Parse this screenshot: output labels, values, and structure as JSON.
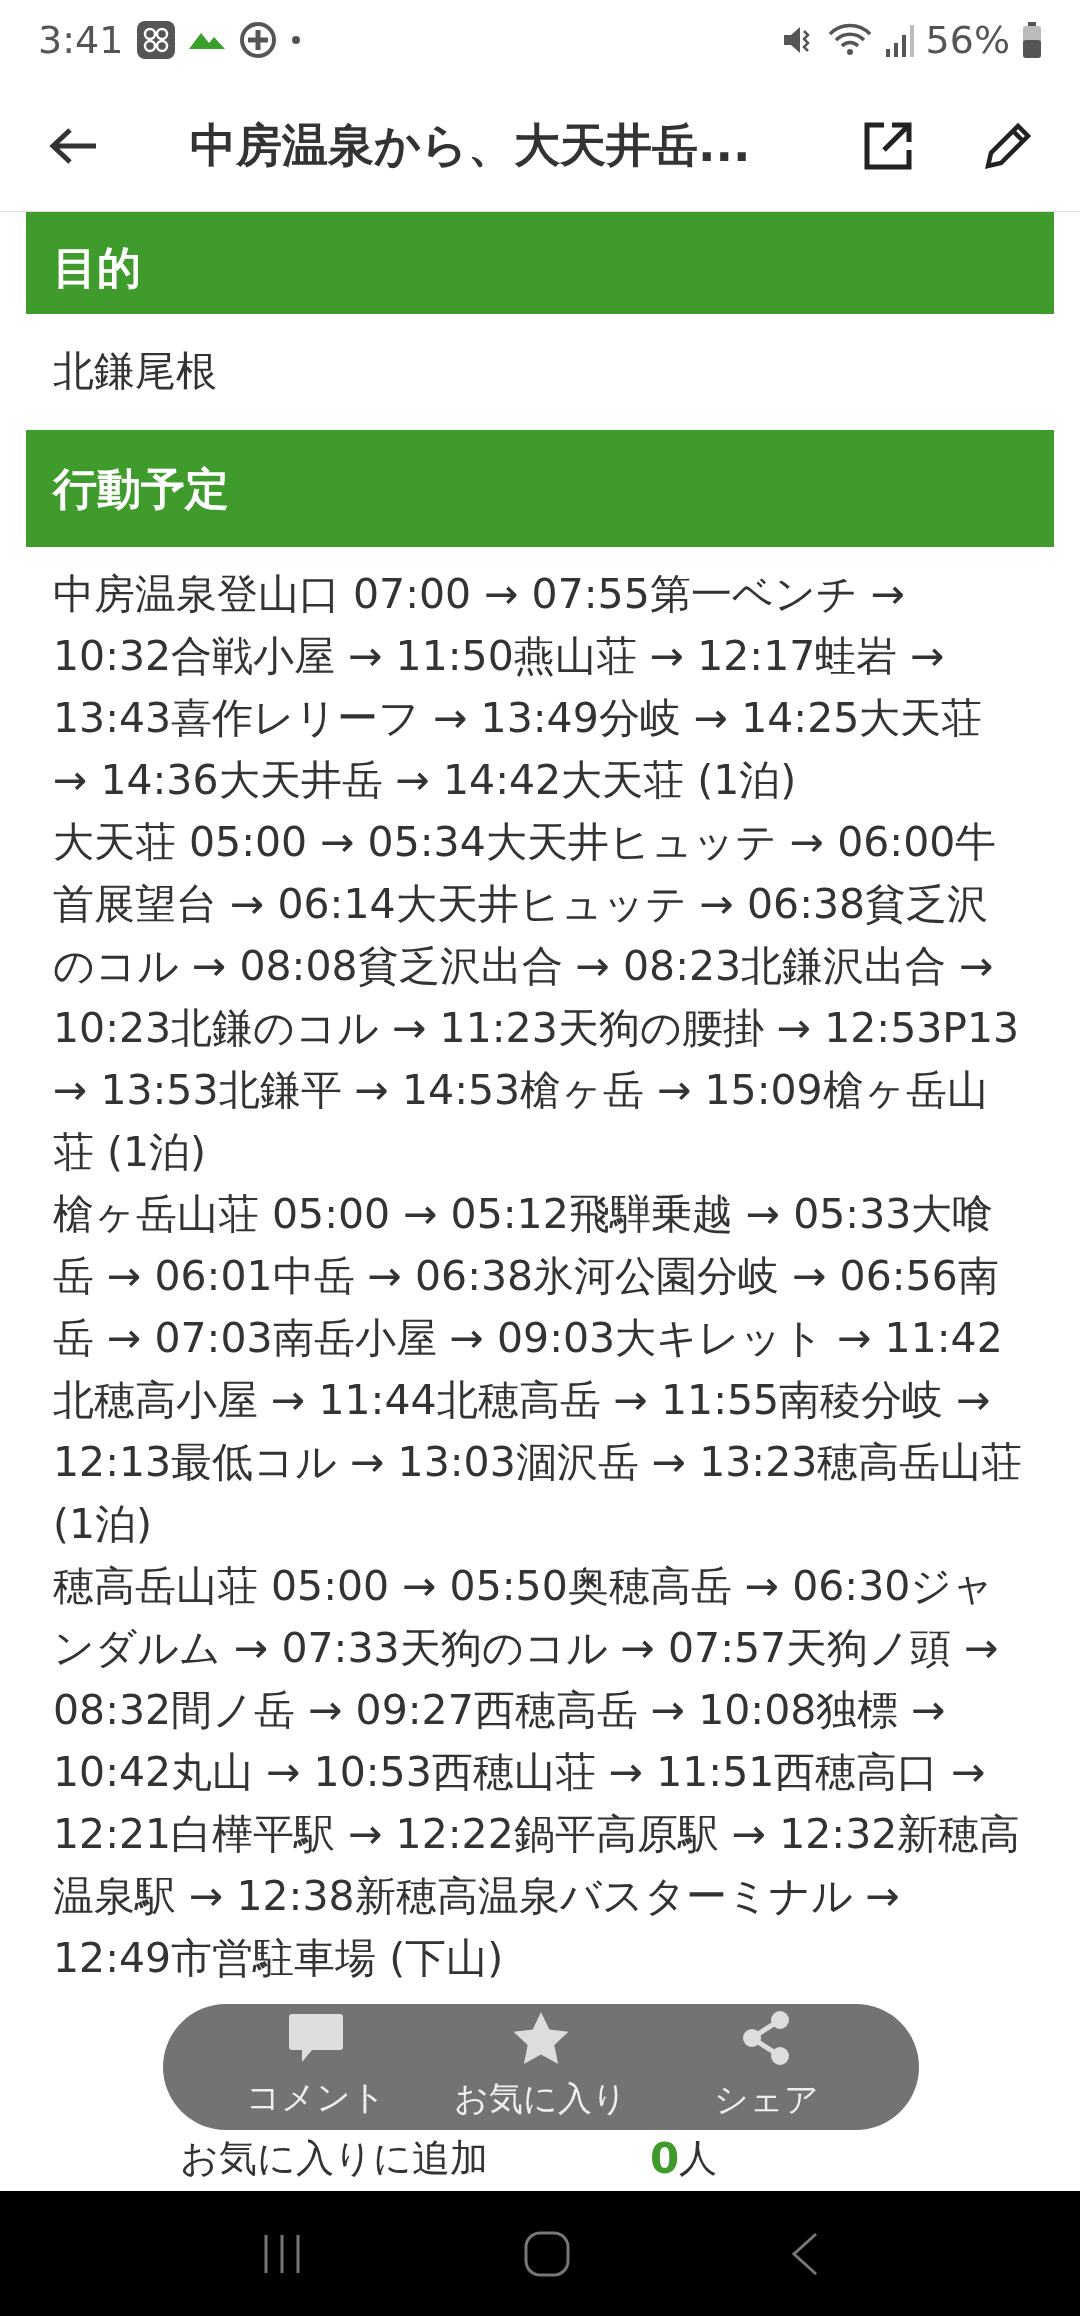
{
  "status_bar": {
    "time": "3:41",
    "battery": "56%"
  },
  "header": {
    "title": "中房温泉から、大天井岳..."
  },
  "sections": [
    {
      "heading": "目的",
      "paragraphs": [
        "北鎌尾根"
      ]
    },
    {
      "heading": "行動予定",
      "paragraphs": [
        "中房温泉登山口 07:00 → 07:55第一ベンチ → 10:32合戦小屋 → 11:50燕山荘 → 12:17蛙岩 → 13:43喜作レリーフ → 13:49分岐 → 14:25大天荘 → 14:36大天井岳 → 14:42大天荘 (1泊)",
        "大天荘 05:00 → 05:34大天井ヒュッテ → 06:00牛首展望台 → 06:14大天井ヒュッテ → 06:38貧乏沢のコル → 08:08貧乏沢出合 → 08:23北鎌沢出合 → 10:23北鎌のコル → 11:23天狗の腰掛 → 12:53P13 → 13:53北鎌平 → 14:53槍ヶ岳 → 15:09槍ヶ岳山荘 (1泊)",
        "槍ヶ岳山荘 05:00 → 05:12飛騨乗越 → 05:33大喰岳 → 06:01中岳 → 06:38氷河公園分岐 → 06:56南岳 → 07:03南岳小屋 → 09:03大キレット → 11:42北穂高小屋 → 11:44北穂高岳 → 11:55南稜分岐 → 12:13最低コル → 13:03涸沢岳 → 13:23穂高岳山荘 (1泊)",
        "穂高岳山荘 05:00 → 05:50奥穂高岳 → 06:30ジャンダルム → 07:33天狗のコル → 07:57天狗ノ頭 → 08:32間ノ岳 → 09:27西穂高岳 → 10:08独標 → 10:42丸山 → 10:53西穂山荘 → 11:51西穂高口 → 12:21白樺平駅 → 12:22鍋平高原駅 → 12:32新穂高温泉駅 → 12:38新穂高温泉バスターミナル → 12:49市営駐車場 (下山)"
      ]
    }
  ],
  "action_bar": {
    "items": [
      {
        "kind": "comment",
        "label": "コメント"
      },
      {
        "kind": "favorite",
        "label": "お気に入り"
      },
      {
        "kind": "share",
        "label": "シェア"
      }
    ]
  },
  "favorites": {
    "label": "お気に入りに追加",
    "count": "0",
    "unit": "人"
  }
}
